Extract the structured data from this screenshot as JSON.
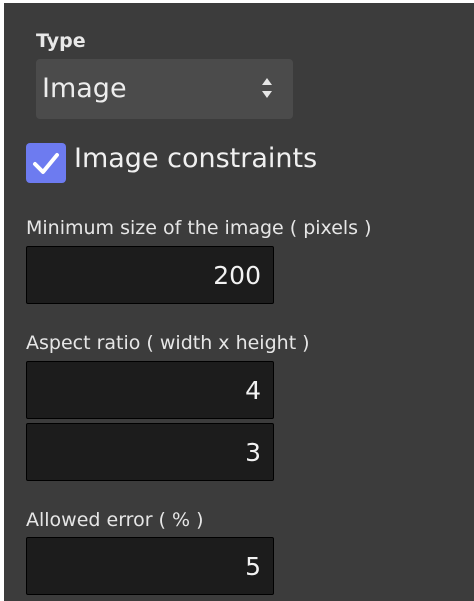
{
  "type_field": {
    "label": "Type",
    "selected": "Image"
  },
  "constraints": {
    "checked": true,
    "label": "Image constraints",
    "accent_color": "#6d7bf0"
  },
  "min_size": {
    "label": "Minimum size of the image ( pixels )",
    "value": "200"
  },
  "aspect_ratio": {
    "label": "Aspect ratio ( width x height )",
    "width_value": "4",
    "height_value": "3"
  },
  "allowed_error": {
    "label": "Allowed error ( % )",
    "value": "5"
  },
  "icons": {
    "select": "up-down-arrows-icon",
    "checkbox": "checkmark-icon"
  }
}
